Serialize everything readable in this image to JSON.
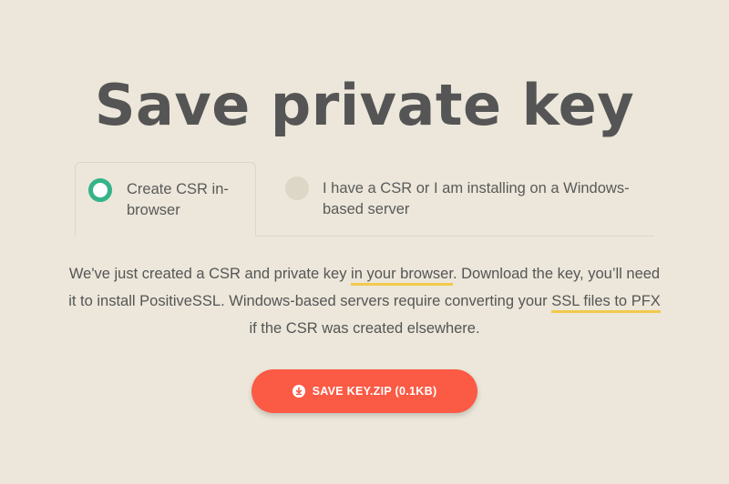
{
  "page": {
    "title": "Save private key"
  },
  "options": [
    {
      "label": "Create CSR in-browser",
      "selected": true
    },
    {
      "label": "I have a CSR or I am installing on a Windows-based server",
      "selected": false
    }
  ],
  "description": {
    "part1": "We've just created a CSR and private key ",
    "link1": "in your browser",
    "part2": ". Download the key, you’ll need it to install PositiveSSL. Windows-based servers require converting your ",
    "link2": "SSL files to PFX",
    "part3": " if the CSR was created elsewhere."
  },
  "save_button": {
    "icon": "download-icon",
    "label": "SAVE KEY.ZIP (0.1KB)"
  },
  "colors": {
    "background": "#ece7da",
    "accent_green": "#35b389",
    "button_red": "#fb5a45",
    "link_underline": "#f2c94c",
    "text": "#555555"
  }
}
